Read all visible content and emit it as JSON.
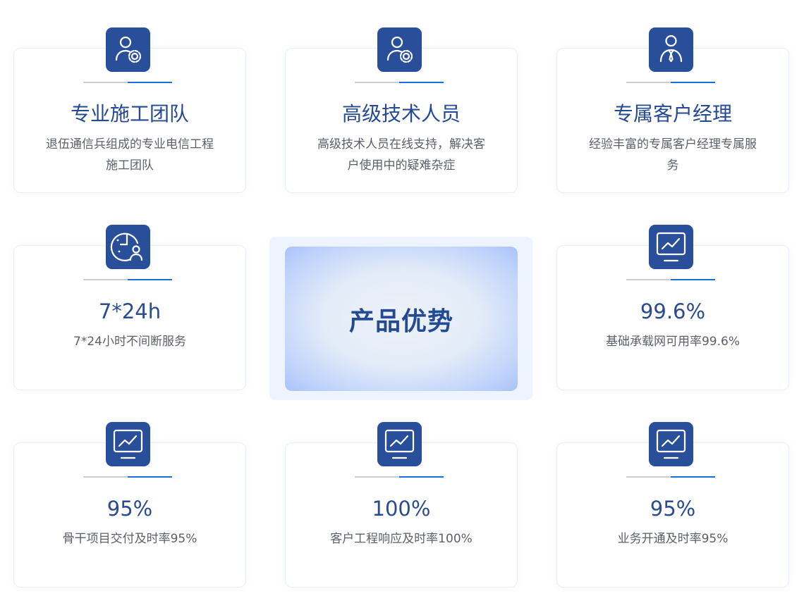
{
  "center": {
    "label": "产品优势"
  },
  "cards": [
    {
      "icon": "user-gear-icon",
      "title": "专业施工团队",
      "desc": "退伍通信兵组成的专业电信工程施工团队"
    },
    {
      "icon": "user-gear-icon",
      "title": "高级技术人员",
      "desc": "高级技术人员在线支持，解决客户使用中的疑难杂症"
    },
    {
      "icon": "manager-icon",
      "title": "专属客户经理",
      "desc": "经验丰富的专属客户经理专属服务"
    },
    {
      "icon": "clock-user-icon",
      "title": "7*24h",
      "desc": "7*24小时不间断服务"
    },
    {
      "icon": "monitor-chart-icon",
      "title": "99.6%",
      "desc": "基础承载网可用率99.6%"
    },
    {
      "icon": "monitor-chart-icon",
      "title": "95%",
      "desc": "骨干项目交付及时率95%"
    },
    {
      "icon": "monitor-chart-icon",
      "title": "100%",
      "desc": "客户工程响应及时率100%"
    },
    {
      "icon": "monitor-chart-icon",
      "title": "95%",
      "desc": "业务开通及时率95%"
    }
  ],
  "colors": {
    "accent": "#294f9a",
    "title": "#254a94",
    "divider_accent": "#1a6fd4",
    "text": "#5a5f68"
  }
}
